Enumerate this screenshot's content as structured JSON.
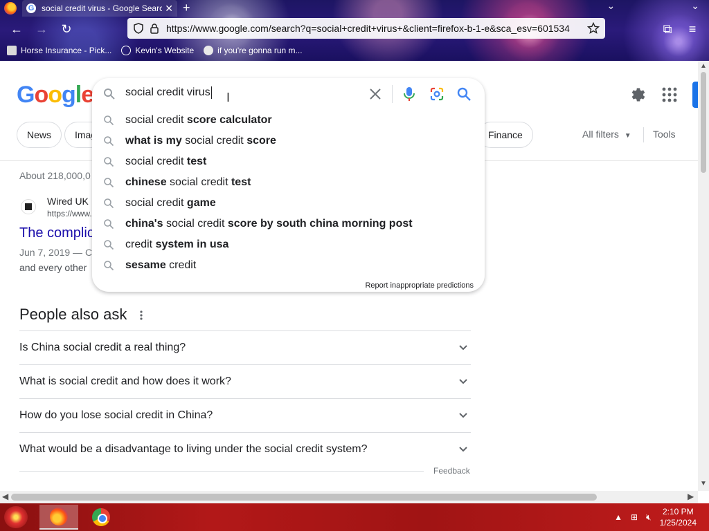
{
  "browser": {
    "tab_title": "social credit virus - Google Search",
    "tab_favicon": "G",
    "url": "https://www.google.com/search?q=social+credit+virus+&client=firefox-b-1-e&sca_esv=601534",
    "bookmarks": [
      {
        "label": "Horse Insurance - Pick...",
        "icon": "horse-icon"
      },
      {
        "label": "Kevin's Website",
        "icon": "globe-icon"
      },
      {
        "label": "if you're gonna run m...",
        "icon": "pumpkin-icon"
      }
    ]
  },
  "google": {
    "logo_letters": [
      "G",
      "o",
      "o",
      "g",
      "l",
      "e"
    ],
    "logo_colors": [
      "#4285F4",
      "#EA4335",
      "#FBBC05",
      "#4285F4",
      "#34A853",
      "#EA4335"
    ],
    "query": "social credit virus",
    "suggestions": [
      [
        {
          "t": "social credit ",
          "b": false
        },
        {
          "t": "score calculator",
          "b": true
        }
      ],
      [
        {
          "t": "what is my",
          "b": true
        },
        {
          "t": " social credit ",
          "b": false
        },
        {
          "t": "score",
          "b": true
        }
      ],
      [
        {
          "t": "social credit ",
          "b": false
        },
        {
          "t": "test",
          "b": true
        }
      ],
      [
        {
          "t": "chinese",
          "b": true
        },
        {
          "t": " social credit ",
          "b": false
        },
        {
          "t": "test",
          "b": true
        }
      ],
      [
        {
          "t": "social credit ",
          "b": false
        },
        {
          "t": "game",
          "b": true
        }
      ],
      [
        {
          "t": "china's",
          "b": true
        },
        {
          "t": " social credit ",
          "b": false
        },
        {
          "t": "score by south china morning post",
          "b": true
        }
      ],
      [
        {
          "t": "credit ",
          "b": false
        },
        {
          "t": "system in usa",
          "b": true
        }
      ],
      [
        {
          "t": "sesame",
          "b": true
        },
        {
          "t": " credit",
          "b": false
        }
      ]
    ],
    "report_label": "Report inappropriate predictions",
    "chips": {
      "news": "News",
      "images": "Imag",
      "finance": "Finance"
    },
    "all_filters": "All filters",
    "tools": "Tools",
    "result_stats": "About 218,000,0",
    "result": {
      "site_name": "Wired UK",
      "site_url": "https://www.",
      "title": "The complic",
      "date": "Jun 7, 2019 — C",
      "snippet": "and every other"
    },
    "paa_title": "People also ask",
    "paa_questions": [
      "Is China social credit a real thing?",
      "What is social credit and how does it work?",
      "How do you lose social credit in China?",
      "What would be a disadvantage to living under the social credit system?"
    ],
    "feedback": "Feedback"
  },
  "taskbar": {
    "time": "2:10 PM",
    "date": "1/25/2024"
  }
}
